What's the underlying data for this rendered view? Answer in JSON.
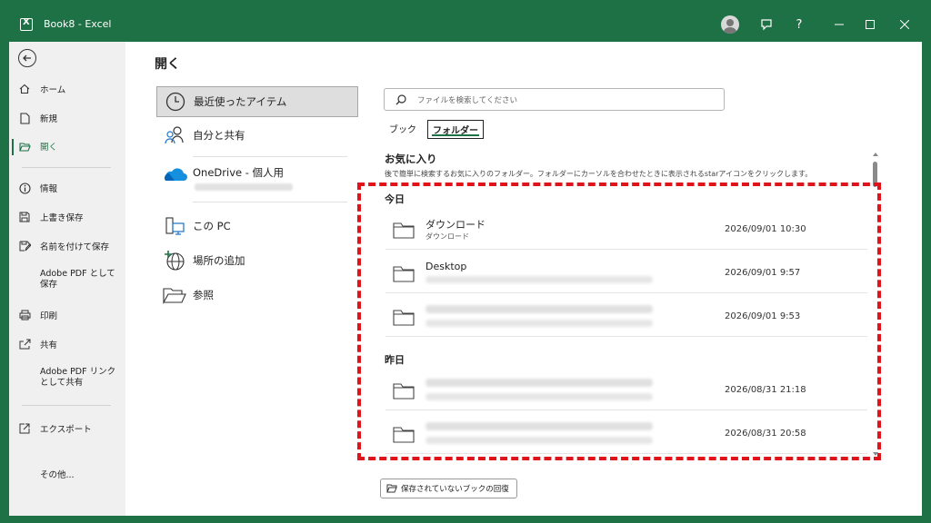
{
  "window": {
    "title": "Book8  -  Excel",
    "app_icon": "excel-icon"
  },
  "titlebar": {
    "icons": [
      "avatar",
      "comment-icon",
      "help-icon",
      "minimize-icon",
      "maximize-icon",
      "close-icon"
    ],
    "help_label": "?"
  },
  "nav": {
    "items": [
      {
        "label": "ホーム",
        "icon": "home-icon"
      },
      {
        "label": "新規",
        "icon": "new-document-icon"
      },
      {
        "label": "開く",
        "icon": "open-folder-icon",
        "active": true
      },
      {
        "label": "情報",
        "icon": "info-icon"
      },
      {
        "label": "上書き保存",
        "icon": "save-icon"
      },
      {
        "label": "名前を付けて保存",
        "icon": "save-as-icon"
      },
      {
        "label": "Adobe PDF として保存",
        "icon": ""
      },
      {
        "label": "印刷",
        "icon": "print-icon"
      },
      {
        "label": "共有",
        "icon": "share-icon"
      },
      {
        "label": "Adobe PDF リンクとして共有",
        "icon": ""
      },
      {
        "label": "エクスポート",
        "icon": "export-icon"
      },
      {
        "label": "その他...",
        "icon": ""
      }
    ]
  },
  "page": {
    "heading": "開く"
  },
  "locations": [
    {
      "label": "最近使ったアイテム",
      "icon": "clock-icon",
      "selected": true
    },
    {
      "label": "自分と共有",
      "icon": "shared-people-icon"
    },
    {
      "label": "OneDrive - 個人用",
      "icon": "onedrive-cloud-icon"
    },
    {
      "label": "この PC",
      "icon": "computer-icon"
    },
    {
      "label": "場所の追加",
      "icon": "add-place-icon"
    },
    {
      "label": "参照",
      "icon": "browse-folder-icon"
    }
  ],
  "search": {
    "placeholder": "ファイルを検索してください",
    "icon": "search-icon"
  },
  "tabs": [
    {
      "label": "ブック",
      "active": false
    },
    {
      "label": "フォルダー",
      "active": true
    }
  ],
  "favorites": {
    "title": "お気に入り",
    "description": "後で簡単に検索するお気に入りのフォルダー。フォルダーにカーソルを合わせたときに表示されるstarアイコンをクリックします。"
  },
  "groups": [
    {
      "label": "今日",
      "rows": [
        {
          "name": "ダウンロード",
          "path": "ダウンロード",
          "date": "2026/09/01 10:30"
        },
        {
          "name": "Desktop",
          "path": "",
          "date": "2026/09/01 9:57"
        },
        {
          "name": "",
          "path": "",
          "date": "2026/09/01 9:53"
        }
      ]
    },
    {
      "label": "昨日",
      "rows": [
        {
          "name": "",
          "path": "",
          "date": "2026/08/31 21:18"
        },
        {
          "name": "",
          "path": "",
          "date": "2026/08/31 20:58"
        }
      ]
    }
  ],
  "footer": {
    "recover_label": "保存されていないブックの回復"
  },
  "colors": {
    "accent": "#1e7145",
    "highlight": "#e0121a"
  }
}
